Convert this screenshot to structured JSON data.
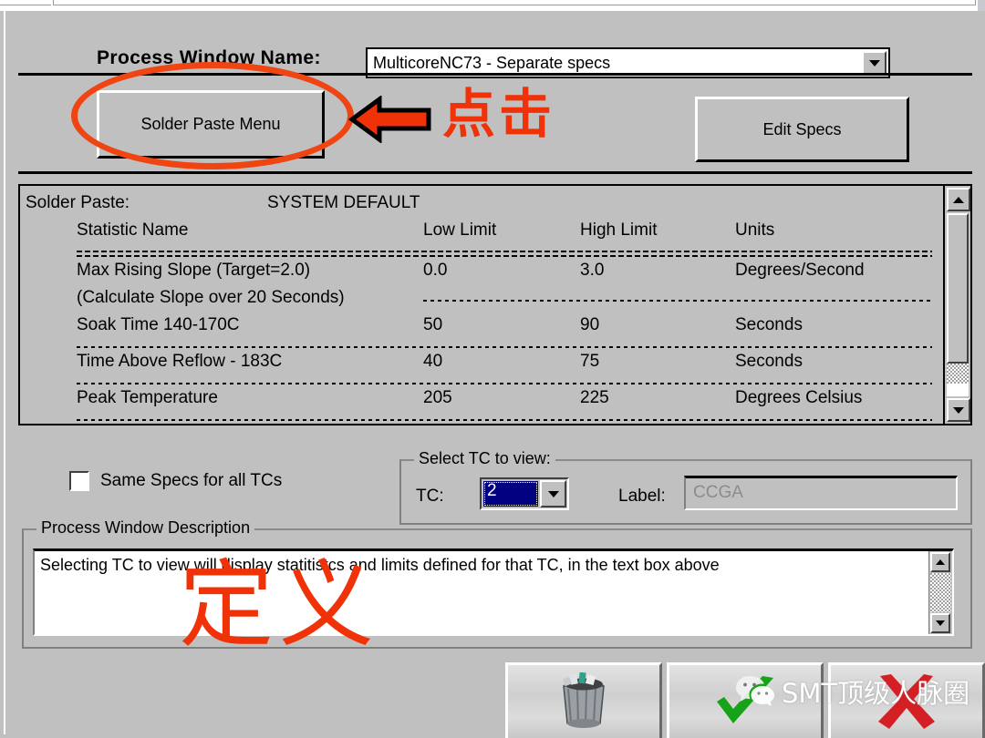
{
  "header": {
    "process_window_label": "Process Window Name:",
    "process_window_value": "MulticoreNC73 - Separate specs"
  },
  "toolbar": {
    "solder_paste_menu": "Solder Paste Menu",
    "edit_specs": "Edit Specs"
  },
  "spec_panel": {
    "paste_label": "Solder Paste:",
    "paste_value": "SYSTEM DEFAULT",
    "columns": [
      "Statistic Name",
      "Low Limit",
      "High Limit",
      "Units"
    ],
    "rows": [
      {
        "name": "Max Rising Slope (Target=2.0)",
        "name2": "(Calculate Slope over 20 Seconds)",
        "low": "0.0",
        "high": "3.0",
        "units": "Degrees/Second"
      },
      {
        "name": "Soak Time 140-170C",
        "low": "50",
        "high": "90",
        "units": "Seconds"
      },
      {
        "name": "Time Above Reflow - 183C",
        "low": "40",
        "high": "75",
        "units": "Seconds"
      },
      {
        "name": "Peak Temperature",
        "low": "205",
        "high": "225",
        "units": "Degrees Celsius"
      }
    ]
  },
  "options": {
    "same_specs_label": "Same Specs for all TCs",
    "same_specs_checked": false
  },
  "select_tc": {
    "group_title": "Select TC to view:",
    "tc_label": "TC:",
    "tc_value": "2",
    "label_label": "Label:",
    "label_value": "CCGA"
  },
  "description": {
    "group_title": "Process Window Description",
    "text": "Selecting TC to view will display statitistcs and limits defined for that TC, in the text box above"
  },
  "bottom_buttons": [
    {
      "name": "delete-button",
      "icon": "trash-can-icon"
    },
    {
      "name": "ok-button",
      "icon": "green-check-icon"
    },
    {
      "name": "cancel-button",
      "icon": "red-x-icon"
    }
  ],
  "annotations": {
    "click_text": "点击",
    "define_text": "定义",
    "arrow": "left-arrow",
    "ellipse": "highlight-ellipse",
    "accent_color": "#f03208"
  },
  "watermark": {
    "text": "SMT顶级人脉圈",
    "icon": "wechat-icon"
  }
}
